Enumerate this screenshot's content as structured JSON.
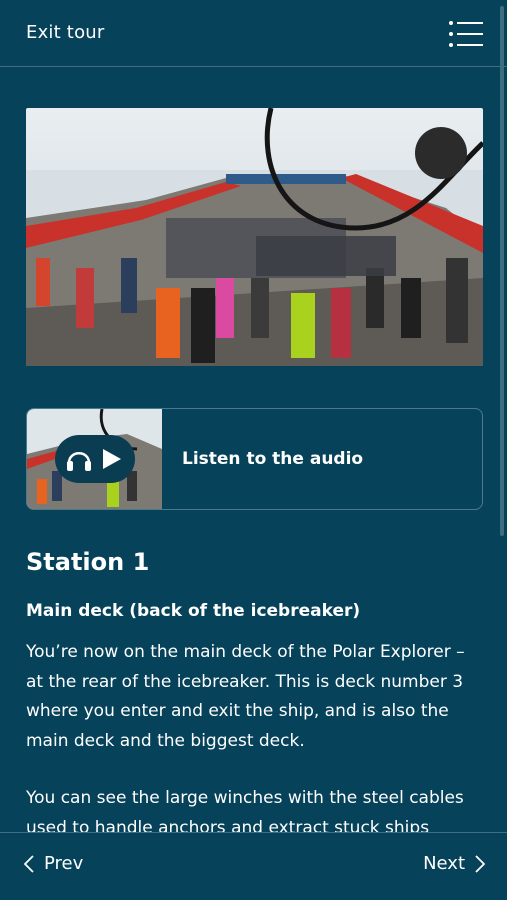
{
  "header": {
    "exit_label": "Exit tour",
    "menu_icon": "list-menu-icon"
  },
  "hero": {
    "image_icon": "icebreaker-deck-photo"
  },
  "audio": {
    "label": "Listen to the audio",
    "headphones_icon": "headphones-icon",
    "play_icon": "play-icon"
  },
  "station": {
    "title": "Station 1",
    "subtitle": "Main deck (back of the icebreaker)",
    "paragraph1": "You’re now on the main deck of the Polar Explorer – at the rear of the icebreaker. This is deck number 3 where you enter and exit the ship, and is also the main deck and the biggest deck.",
    "paragraph2": "You can see the large winches with the steel cables used to handle anchors and extract stuck ships"
  },
  "footer": {
    "prev_label": "Prev",
    "next_label": "Next"
  },
  "colors": {
    "background": "#06425a",
    "divider": "#3e6f83",
    "text": "#ffffff",
    "hull_red": "#c8322a"
  }
}
